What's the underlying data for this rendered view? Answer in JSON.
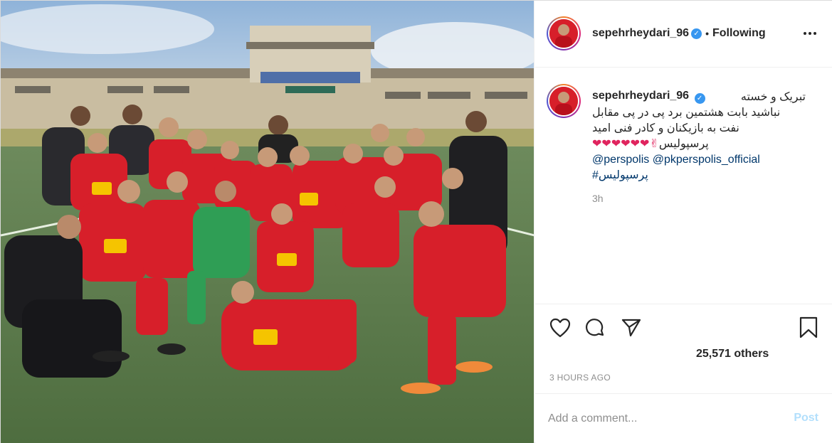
{
  "header": {
    "username": "sepehrheydari_96",
    "separator": "•",
    "follow_status": "Following",
    "verified_mark": "✓"
  },
  "caption": {
    "username": "sepehrheydari_96",
    "line1": "تبریک و خسته",
    "line2": "نباشید بابت هشتمین برد پی در پی مقابل",
    "line3": "نفت به بازیکنان و کادر فنی امید",
    "line4_text": "پرسپولیس",
    "line4_emoji": "❤❤❤❤❤❤✌",
    "mentions": "@perspolis @pkperspolis_official",
    "hashtag": "#پرسپولیس",
    "time_ago": "3h"
  },
  "actions": {
    "like_icon": "heart-icon",
    "comment_icon": "comment-icon",
    "share_icon": "share-icon",
    "save_icon": "bookmark-icon"
  },
  "likes": {
    "text": "25,571 others"
  },
  "timestamp": "3 HOURS AGO",
  "comment": {
    "placeholder": "Add a comment...",
    "post_label": "Post"
  },
  "colors": {
    "accent": "#3897f0",
    "link": "#00376b",
    "muted": "#8e8e8e",
    "post_disabled": "#b2dffc",
    "jersey_red": "#d71f2a"
  }
}
